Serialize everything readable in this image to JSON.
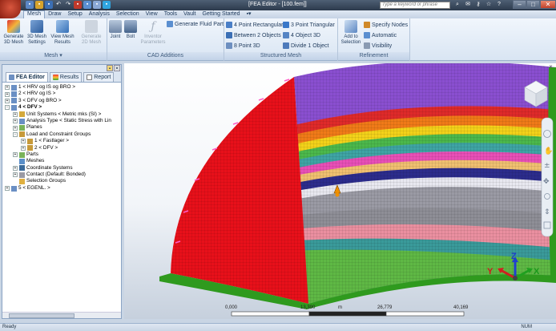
{
  "window": {
    "title": "[FEA Editor - [100.fem]]",
    "search_placeholder": "Type a keyword or phrase"
  },
  "tabs": [
    {
      "label": "Mesh",
      "active": true
    },
    {
      "label": "Draw"
    },
    {
      "label": "Setup"
    },
    {
      "label": "Analysis"
    },
    {
      "label": "Selection"
    },
    {
      "label": "View"
    },
    {
      "label": "Tools"
    },
    {
      "label": "Vault"
    },
    {
      "label": "Getting Started"
    }
  ],
  "ribbon": {
    "mesh_group": {
      "label": "Mesh",
      "generate_3d_mesh": "Generate 3D Mesh",
      "mesh_settings": "3D Mesh Settings",
      "view_mesh_results": "View Mesh Results",
      "generate_2d_mesh": "Generate 2D Mesh"
    },
    "cad_group": {
      "label": "CAD Additions",
      "joint": "Joint",
      "bolt": "Bolt",
      "inventor_params": "Inventor Parameters",
      "generate_fluid_part": "Generate Fluid Part"
    },
    "structured_group": {
      "label": "Structured Mesh",
      "four_point_rect": "4 Point Rectangular",
      "between_objects": "Between 2 Objects",
      "eight_point_3d": "8 Point 3D",
      "three_point_tri": "3 Point Triangular",
      "four_object_3d": "4 Object 3D",
      "divide_object": "Divide 1 Object"
    },
    "refinement_group": {
      "label": "Refinement",
      "add_to_selection": "Add to Selection",
      "specify_nodes": "Specify Nodes",
      "automatic": "Automatic",
      "visibility": "Visibility"
    }
  },
  "panel": {
    "tabs": [
      "FEA Editor",
      "Results",
      "Report"
    ],
    "tree": [
      {
        "label": "1 < HRV og IS og BRO >",
        "indent": 0,
        "exp": "+"
      },
      {
        "label": "2 < HRV og IS >",
        "indent": 0,
        "exp": "+"
      },
      {
        "label": "3 < DFV og BRO >",
        "indent": 0,
        "exp": "+"
      },
      {
        "label": "4 < DFV >",
        "indent": 0,
        "exp": "-",
        "bold": true
      },
      {
        "label": "Unit Systems < Metric mks (SI) >",
        "indent": 1,
        "exp": "+"
      },
      {
        "label": "Analysis Type < Static Stress with Lin",
        "indent": 1,
        "exp": "+"
      },
      {
        "label": "Planes",
        "indent": 1,
        "exp": "+"
      },
      {
        "label": "Load and Constraint Groups",
        "indent": 1,
        "exp": "-"
      },
      {
        "label": "1 < Fastlager >",
        "indent": 2,
        "exp": "+"
      },
      {
        "label": "2 < DFV >",
        "indent": 2,
        "exp": "+"
      },
      {
        "label": "Parts",
        "indent": 1,
        "exp": "+"
      },
      {
        "label": "Meshes",
        "indent": 1,
        "exp": ""
      },
      {
        "label": "Coordinate Systems",
        "indent": 1,
        "exp": "+"
      },
      {
        "label": "Contact (Default: Bonded)",
        "indent": 1,
        "exp": "+"
      },
      {
        "label": "Selection Groups",
        "indent": 1,
        "exp": ""
      },
      {
        "label": "5 < EGENL. >",
        "indent": 0,
        "exp": "+"
      }
    ]
  },
  "scale_bar": {
    "ticks": [
      "0,000",
      "13,390",
      "m",
      "26,779",
      "40,169"
    ]
  },
  "triad": {
    "x": "X",
    "y": "Y",
    "z": "Z"
  },
  "status": {
    "left": "Ready",
    "right": "NUM"
  },
  "colors": {
    "accent": "#1e395b",
    "mesh_red": "#e8101a",
    "mesh_purple": "#8a4fd0",
    "mesh_green": "#2f9a1e"
  }
}
